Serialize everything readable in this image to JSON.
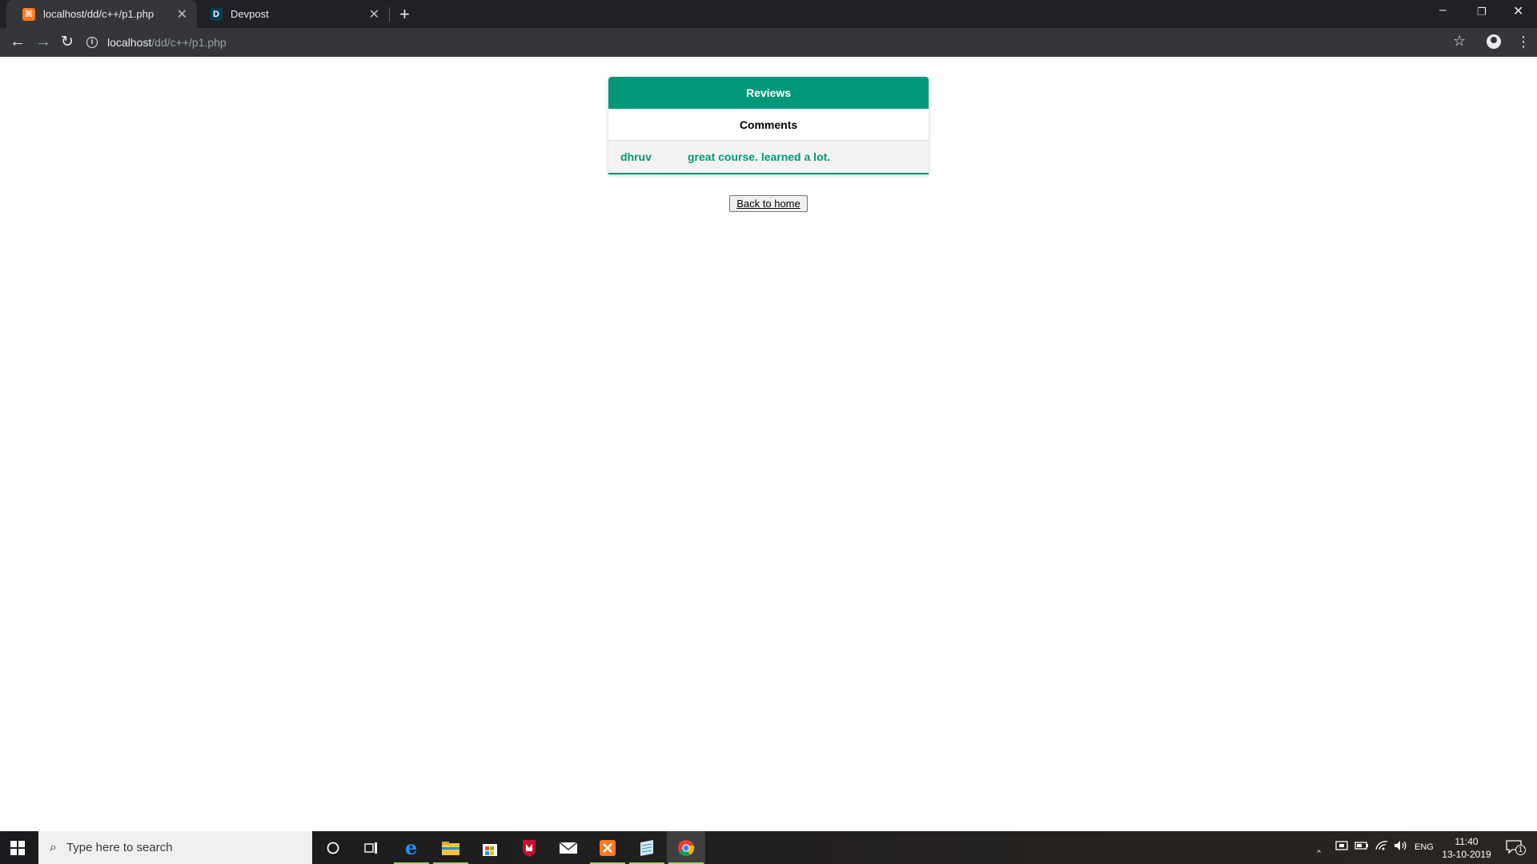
{
  "browser": {
    "tabs": [
      {
        "title": "localhost/dd/c++/p1.php",
        "favicon": "xampp-icon",
        "active": true
      },
      {
        "title": "Devpost",
        "favicon": "devpost-icon",
        "favicon_letter": "D",
        "active": false
      }
    ],
    "url": {
      "host": "localhost",
      "path": "/dd/c++/p1.php"
    },
    "colors": {
      "tabbar": "#202124",
      "toolbar": "#35363a"
    }
  },
  "page": {
    "table_title": "Reviews",
    "column_header": "Comments",
    "reviews": [
      {
        "user": "dhruv",
        "comment": "great course. learned a lot."
      }
    ],
    "back_button_label": "Back to home",
    "colors": {
      "accent": "#009879",
      "row_bg": "#f3f3f3"
    }
  },
  "taskbar": {
    "search_placeholder": "Type here to search",
    "language": "ENG",
    "time": "11:40",
    "date": "13-10-2019",
    "notification_count": "1"
  }
}
